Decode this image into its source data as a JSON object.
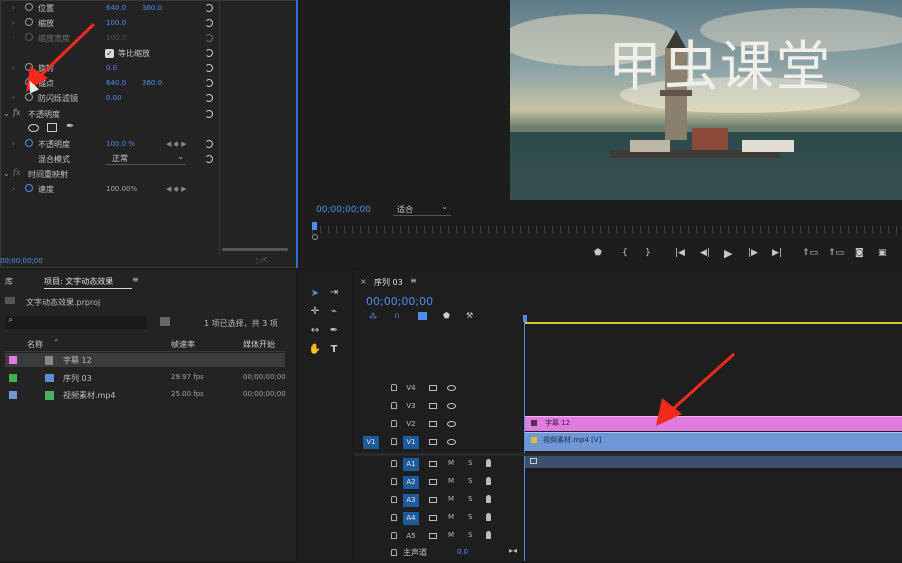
{
  "effect_controls": {
    "rows": [
      {
        "label": "位置",
        "v1": "640.0",
        "v2": "360.0"
      },
      {
        "label": "缩放",
        "v1": "100.0"
      },
      {
        "label": "缩放宽度",
        "v1": "100.0"
      },
      {
        "label": "等比缩放"
      },
      {
        "label": "旋转",
        "v1": "0.0"
      },
      {
        "label": "锚点",
        "v1": "640.0",
        "v2": "360.0"
      },
      {
        "label": "防闪烁滤镜",
        "v1": "0.00"
      }
    ],
    "fx_label": "fx",
    "opacity_section": "不透明度",
    "opacity_label": "不透明度",
    "opacity_value": "100.0 %",
    "blend_label": "混合模式",
    "blend_value": "正常",
    "time_remap_section": "时间重映射",
    "speed_label": "速度",
    "speed_value": "100.00%",
    "timecode": "00;00;00;00"
  },
  "program_monitor": {
    "overlay_text": "甲虫课堂",
    "timecode": "00;00;00;00",
    "fit_label": "适合"
  },
  "project_panel": {
    "tab_library": "库",
    "tab_project": "项目: 文字动态效果",
    "file": "文字动态效果.prproj",
    "selection_info": "1 项已选择，共 3 项",
    "columns": {
      "name": "名称",
      "fps": "帧速率",
      "start": "媒体开始"
    },
    "items": [
      {
        "name": "字幕 12",
        "fps": "",
        "start": "",
        "color": "#e07be0"
      },
      {
        "name": "序列 03",
        "fps": "29.97 fps",
        "start": "00;00;00;00",
        "color": "#3fb34b"
      },
      {
        "name": "视频素材.mp4",
        "fps": "25.00 fps",
        "start": "00;00;00;00",
        "color": "#6f97d6"
      }
    ]
  },
  "timeline": {
    "tab": "序列 03",
    "timecode": "00;00;00;00",
    "video_tracks": [
      "V4",
      "V3",
      "V2",
      "V1"
    ],
    "src_v": "V1",
    "audio_tracks": [
      "A1",
      "A2",
      "A3",
      "A4",
      "A5"
    ],
    "master_label": "主声道",
    "master_value": "0.0",
    "clip_title": "字幕 12",
    "clip_video": "视频素材.mp4 [V]",
    "m_label": "M",
    "s_label": "S"
  },
  "colors": {
    "accent": "#4c8ee8",
    "title_clip": "#e07be0",
    "video_clip": "#6f97d6",
    "selected_track": "#1d5c9c"
  }
}
